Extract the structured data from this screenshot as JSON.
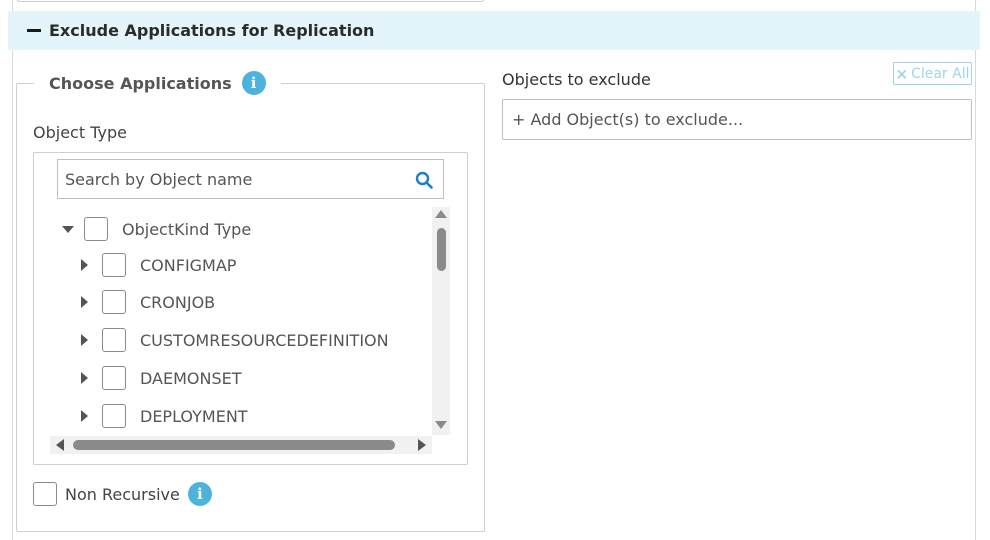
{
  "section": {
    "title": "Exclude Applications for Replication",
    "collapse_icon": "minus-icon"
  },
  "choose_applications": {
    "legend": "Choose Applications",
    "info_icon": "i",
    "object_type_label": "Object Type",
    "search": {
      "placeholder": "Search by Object name",
      "value": ""
    },
    "tree": {
      "root": {
        "label": "ObjectKind Type",
        "expanded": true,
        "checked": false
      },
      "items": [
        {
          "label": "CONFIGMAP",
          "expanded": false,
          "checked": false
        },
        {
          "label": "CRONJOB",
          "expanded": false,
          "checked": false
        },
        {
          "label": "CUSTOMRESOURCEDEFINITION",
          "expanded": false,
          "checked": false
        },
        {
          "label": "DAEMONSET",
          "expanded": false,
          "checked": false
        },
        {
          "label": "DEPLOYMENT",
          "expanded": false,
          "checked": false
        }
      ]
    },
    "non_recursive": {
      "label": "Non Recursive",
      "checked": false,
      "info_icon": "i"
    }
  },
  "objects_to_exclude": {
    "label": "Objects to exclude",
    "clear_all_icon": "×",
    "clear_all": "Clear All",
    "add_placeholder": "+ Add Object(s) to exclude..."
  },
  "colors": {
    "header_bg": "#e3f4fa",
    "info_icon": "#4db3dd",
    "clear_all": "#9dd6ea"
  }
}
